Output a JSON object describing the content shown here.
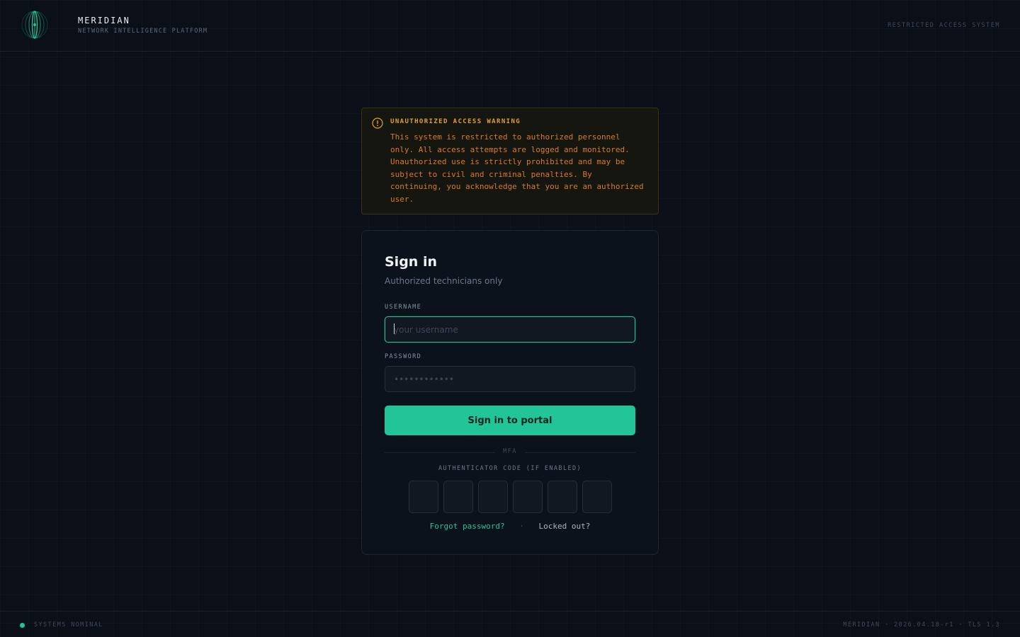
{
  "header": {
    "brand_name": "MERIDIAN",
    "brand_subtitle": "NETWORK INTELLIGENCE PLATFORM",
    "right_label": "RESTRICTED ACCESS SYSTEM"
  },
  "warning": {
    "title": "UNAUTHORIZED ACCESS WARNING",
    "body": "This system is restricted to authorized personnel only. All access attempts are logged and monitored. Unauthorized use is strictly prohibited and may be subject to civil and criminal penalties. By continuing, you acknowledge that you are an authorized user.",
    "icon": "warning-circle-icon",
    "color": "#d97a2b"
  },
  "signin": {
    "title": "Sign in",
    "subtitle": "Authorized technicians only",
    "username_label": "USERNAME",
    "username_placeholder": "your username",
    "username_value": "",
    "password_label": "PASSWORD",
    "password_placeholder": "••••••••••••",
    "password_value": "",
    "submit_label": "Sign in to portal",
    "divider_label": "MFA",
    "mfa_label": "AUTHENTICATOR CODE (IF ENABLED)",
    "otp_digits": [
      "",
      "",
      "",
      "",
      "",
      ""
    ],
    "forgot_link": "Forgot password?",
    "separator": "·",
    "locked_link": "Locked out?"
  },
  "footer": {
    "status": "SYSTEMS NOMINAL",
    "version": "MERIDIAN · 2026.04.18-r1 · TLS 1.3"
  },
  "colors": {
    "accent": "#22c597",
    "background": "#0a0f18",
    "warning": "#e0a030"
  }
}
